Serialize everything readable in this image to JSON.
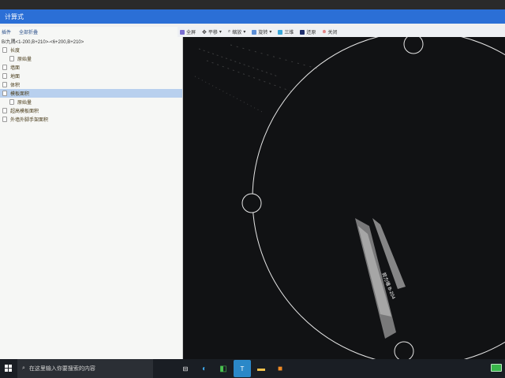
{
  "window": {
    "title": "计算式"
  },
  "left_toolbar": {
    "item1": "插件",
    "item2": "全部折叠"
  },
  "formula": "B/九隅<1-200,B+210>-<6+200,B+210>",
  "tree": [
    {
      "label": "长度",
      "level": 0,
      "selected": false
    },
    {
      "label": "原始量",
      "level": 1,
      "selected": false
    },
    {
      "label": "墙面",
      "level": 0,
      "selected": false
    },
    {
      "label": "地面",
      "level": 0,
      "selected": false
    },
    {
      "label": "体积",
      "level": 0,
      "selected": false
    },
    {
      "label": "模板面积",
      "level": 0,
      "selected": true
    },
    {
      "label": "原始量",
      "level": 1,
      "selected": false
    },
    {
      "label": "超高模板面积",
      "level": 0,
      "selected": false
    },
    {
      "label": "外墙外脚手架面积",
      "level": 0,
      "selected": false
    }
  ],
  "right_toolbar": {
    "fullscreen": "全屏",
    "pan": "平移",
    "zoom": "缩放",
    "rotate": "旋转",
    "three_d": "三维",
    "restore": "还原",
    "close": "关闭"
  },
  "canvas": {
    "wall_label": "剪力墙 B-204"
  },
  "taskbar": {
    "search_placeholder": "在这里输入你要搜索的内容"
  },
  "colors": {
    "titlebar": "#2b6fd6",
    "canvas_bg": "#111214",
    "selection": "#b8d0ee",
    "taskbar": "#1a1e24"
  }
}
